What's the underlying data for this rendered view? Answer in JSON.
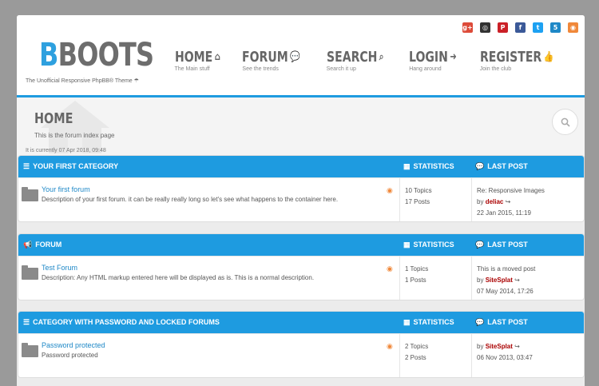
{
  "header": {
    "logo_b": "B",
    "logo_rest": "BOOTS",
    "tagline": "The Unofficial Responsive PhpBB® Theme ☂",
    "social": [
      {
        "name": "google-plus-icon",
        "glyph": "g+",
        "color": "#dd4b39"
      },
      {
        "name": "github-icon",
        "glyph": "◎",
        "color": "#333333"
      },
      {
        "name": "pinterest-icon",
        "glyph": "P",
        "color": "#cb2027"
      },
      {
        "name": "facebook-icon",
        "glyph": "f",
        "color": "#3b5998"
      },
      {
        "name": "twitter-icon",
        "glyph": "t",
        "color": "#1da1f2"
      },
      {
        "name": "html5-icon",
        "glyph": "5",
        "color": "#1e88c7"
      },
      {
        "name": "rss-icon",
        "glyph": "◉",
        "color": "#f0883a"
      }
    ],
    "nav": [
      {
        "label": "HOME",
        "sub": "The Main stuff",
        "icon": "home-icon",
        "glyph": "⌂"
      },
      {
        "label": "FORUM",
        "sub": "See the trends",
        "icon": "comments-icon",
        "glyph": "💬"
      },
      {
        "label": "SEARCH",
        "sub": "Search it up",
        "icon": "search-icon",
        "glyph": "⌕"
      },
      {
        "label": "LOGIN",
        "sub": "Hang around",
        "icon": "sign-in-icon",
        "glyph": "➜"
      },
      {
        "label": "REGISTER",
        "sub": "Join the club",
        "icon": "thumbs-up-icon",
        "glyph": "👍"
      }
    ]
  },
  "banner": {
    "title": "HOME",
    "description": "This is the forum index page",
    "current_time": "It is currently 07 Apr 2018, 09:48"
  },
  "columns": {
    "statistics": "STATISTICS",
    "last_post": "LAST POST"
  },
  "categories": [
    {
      "title": "YOUR FIRST CATEGORY",
      "icon": "list-icon",
      "glyph": "☰",
      "forum": {
        "title": "Your first forum",
        "description": "Description of your first forum. it can be really really long so let's see what happens to the container here.",
        "topics": "10 Topics",
        "posts": "17 Posts",
        "last_subject": "Re: Responsive Images",
        "last_by": "by",
        "last_author": "deliac",
        "last_date": "22 Jan 2015, 11:19"
      }
    },
    {
      "title": "FORUM",
      "icon": "bullhorn-icon",
      "glyph": "📢",
      "forum": {
        "title": "Test Forum",
        "description": "Description: Any HTML markup entered here will be displayed as is. This is a normal description.",
        "topics": "1 Topics",
        "posts": "1 Posts",
        "last_subject": "This is a moved post",
        "last_by": "by",
        "last_author": "SiteSplat",
        "last_date": "07 May 2014, 17:26"
      }
    },
    {
      "title": "CATEGORY WITH PASSWORD AND LOCKED FORUMS",
      "icon": "list-icon",
      "glyph": "☰",
      "forum": {
        "title": "Password protected",
        "description": "Password protected",
        "topics": "2 Topics",
        "posts": "2 Posts",
        "last_subject": "",
        "last_by": "by",
        "last_author": "SiteSplat",
        "last_date": "06 Nov 2013, 03:47"
      }
    }
  ]
}
